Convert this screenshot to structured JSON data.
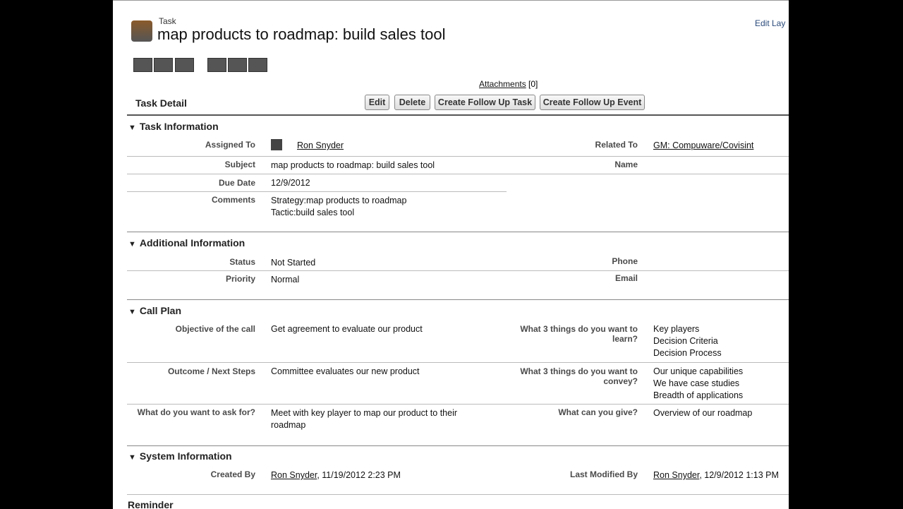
{
  "header": {
    "object_type": "Task",
    "title": "map products to roadmap: build sales tool",
    "edit_layout": "Edit Lay",
    "attachments_label": "Attachments",
    "attachments_count": "[0]"
  },
  "detail": {
    "title": "Task Detail",
    "buttons": {
      "edit": "Edit",
      "delete": "Delete",
      "follow_task": "Create Follow Up Task",
      "follow_event": "Create Follow Up Event"
    }
  },
  "task_info": {
    "title": "Task Information",
    "assigned_to_label": "Assigned To",
    "assigned_to": "Ron Snyder",
    "related_to_label": "Related To",
    "related_to": "GM: Compuware/Covisint",
    "subject_label": "Subject",
    "subject": "map products to roadmap: build sales tool",
    "name_label": "Name",
    "due_label": "Due Date",
    "due": "12/9/2012",
    "comments_label": "Comments",
    "comments_1": "Strategy:map products to roadmap",
    "comments_2": "Tactic:build sales tool"
  },
  "additional": {
    "title": "Additional Information",
    "status_label": "Status",
    "status": "Not Started",
    "phone_label": "Phone",
    "priority_label": "Priority",
    "priority": "Normal",
    "email_label": "Email"
  },
  "call_plan": {
    "title": "Call Plan",
    "objective_label": "Objective of the call",
    "objective": "Get agreement to evaluate our product",
    "learn_label_1": "What 3 things do you want to",
    "learn_label_2": "learn?",
    "learn": [
      "Key players",
      "Decision Criteria",
      "Decision Process"
    ],
    "outcome_label": "Outcome / Next Steps",
    "outcome": "Committee evaluates our new product",
    "convey_label_1": "What 3 things do you want to",
    "convey_label_2": "convey?",
    "convey": [
      "Our unique capabilities",
      "We have case studies",
      "Breadth of applications"
    ],
    "ask_label": "What do you want to ask for?",
    "ask_1": "Meet with key player to map our product to their",
    "ask_2": "roadmap",
    "give_label": "What can you give?",
    "give": "Overview of our roadmap"
  },
  "system": {
    "title": "System Information",
    "created_label": "Created By",
    "created_by": "Ron Snyder",
    "created_date": ", 11/19/2012 2:23 PM",
    "modified_label": "Last Modified By",
    "modified_by": "Ron Snyder",
    "modified_date": ", 12/9/2012 1:13 PM"
  },
  "reminder": {
    "title": "Reminder"
  }
}
